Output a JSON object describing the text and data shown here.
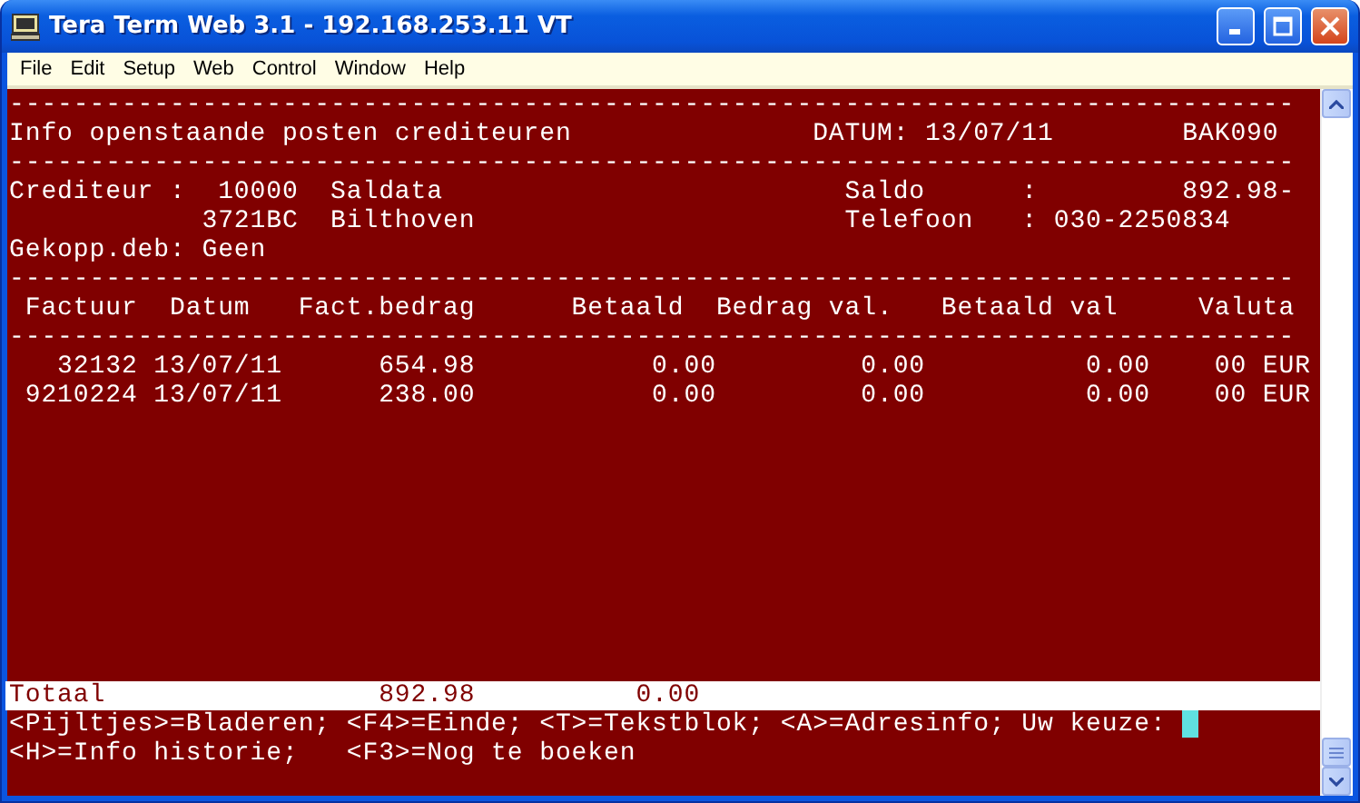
{
  "window": {
    "title": "Tera Term Web 3.1 - 192.168.253.11 VT"
  },
  "menu": [
    "File",
    "Edit",
    "Setup",
    "Web",
    "Control",
    "Window",
    "Help"
  ],
  "terminal": {
    "top_lines": [
      {
        "text": "--------------------------------------------------------------------------------",
        "highlighted": false,
        "cursor": false
      },
      {
        "text": "Info openstaande posten crediteuren               DATUM: 13/07/11        BAK090",
        "highlighted": false,
        "cursor": false
      },
      {
        "text": "--------------------------------------------------------------------------------",
        "highlighted": false,
        "cursor": false
      },
      {
        "text": "Crediteur :  10000  Saldata                         Saldo      :         892.98-",
        "highlighted": false,
        "cursor": false
      },
      {
        "text": "            3721BC  Bilthoven                       Telefoon   : 030-2250834",
        "highlighted": false,
        "cursor": false
      },
      {
        "text": "Gekopp.deb: Geen",
        "highlighted": false,
        "cursor": false
      },
      {
        "text": "--------------------------------------------------------------------------------",
        "highlighted": false,
        "cursor": false
      },
      {
        "text": " Factuur  Datum   Fact.bedrag      Betaald  Bedrag val.   Betaald val     Valuta",
        "highlighted": false,
        "cursor": false
      },
      {
        "text": "--------------------------------------------------------------------------------",
        "highlighted": false,
        "cursor": false
      },
      {
        "text": "   32132 13/07/11      654.98           0.00         0.00          0.00    00 EUR",
        "highlighted": false,
        "cursor": false
      },
      {
        "text": " 9210224 13/07/11      238.00           0.00         0.00          0.00    00 EUR",
        "highlighted": false,
        "cursor": false
      }
    ],
    "bottom_lines": [
      {
        "text": "Totaal                 892.98          0.00",
        "highlighted": true,
        "cursor": false
      },
      {
        "text": "<Pijltjes>=Bladeren; <F4>=Einde; <T>=Tekstblok; <A>=Adresinfo; Uw keuze: ",
        "highlighted": false,
        "cursor": true
      },
      {
        "text": "<H>=Info historie;   <F3>=Nog te boeken",
        "highlighted": false,
        "cursor": false
      }
    ]
  }
}
